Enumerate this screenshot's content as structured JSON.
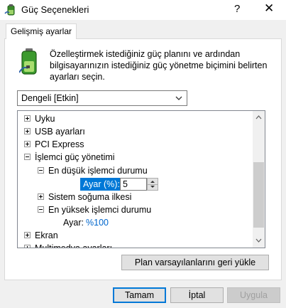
{
  "window": {
    "title": "Güç Seçenekleri",
    "help_glyph": "?",
    "close_glyph": "✕"
  },
  "tabs": [
    {
      "label": "Gelişmiş ayarlar"
    }
  ],
  "description": "Özelleştirmek istediğiniz güç planını ve ardından bilgisayarınızın istediğiniz güç yönetme biçimini belirten ayarları seçin.",
  "plan_select": {
    "value": "Dengeli [Etkin]"
  },
  "tree": {
    "items": [
      {
        "label": "Uyku",
        "expander": "plus"
      },
      {
        "label": "USB ayarları",
        "expander": "plus"
      },
      {
        "label": "PCI Express",
        "expander": "plus"
      },
      {
        "label": "İşlemci güç yönetimi",
        "expander": "minus"
      },
      {
        "label": "En düşük işlemci durumu",
        "expander": "minus"
      },
      {
        "label": "Ayar (%):",
        "value": "5"
      },
      {
        "label": "Sistem soğuma ilkesi",
        "expander": "plus"
      },
      {
        "label": "En yüksek işlemci durumu",
        "expander": "minus"
      },
      {
        "label": "Ayar:",
        "value": "%100"
      },
      {
        "label": "Ekran",
        "expander": "plus"
      },
      {
        "label": "Multimedya ayarları",
        "expander": "plus"
      }
    ]
  },
  "buttons": {
    "restore_defaults": "Plan varsayılanlarını geri yükle",
    "ok": "Tamam",
    "cancel": "İptal",
    "apply": "Uygula"
  },
  "colors": {
    "selection": "#0078d7",
    "link_value": "#0066cc",
    "window_bg": "#f0f0f0"
  }
}
